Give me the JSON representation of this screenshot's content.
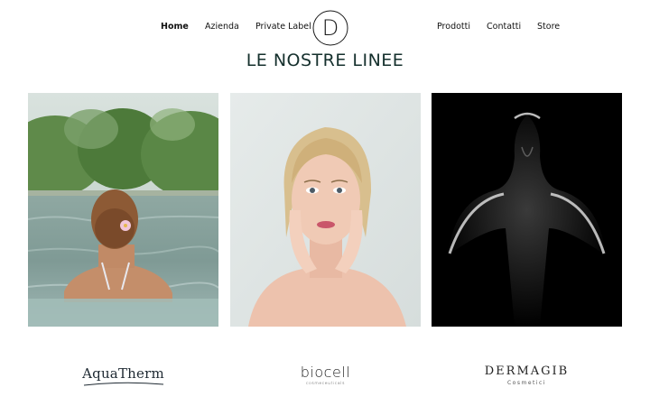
{
  "nav": {
    "home": "Home",
    "azienda": "Azienda",
    "private_label": "Private Label",
    "prodotti": "Prodotti",
    "contatti": "Contatti",
    "store": "Store",
    "logo_letter": "D"
  },
  "page": {
    "title": "LE NOSTRE LINEE"
  },
  "lines": [
    {
      "image": "woman-in-pool-photo",
      "brand": "AquaTherm",
      "brand_sub": ""
    },
    {
      "image": "blonde-woman-portrait-photo",
      "brand": "biocell",
      "brand_sub": "cosmeceuticals"
    },
    {
      "image": "silhouette-dark-photo",
      "brand": "DERMAGIB",
      "brand_sub": "Cosmetici"
    }
  ],
  "colors": {
    "title": "#15302d",
    "nav_text": "#111111",
    "background": "#ffffff"
  }
}
